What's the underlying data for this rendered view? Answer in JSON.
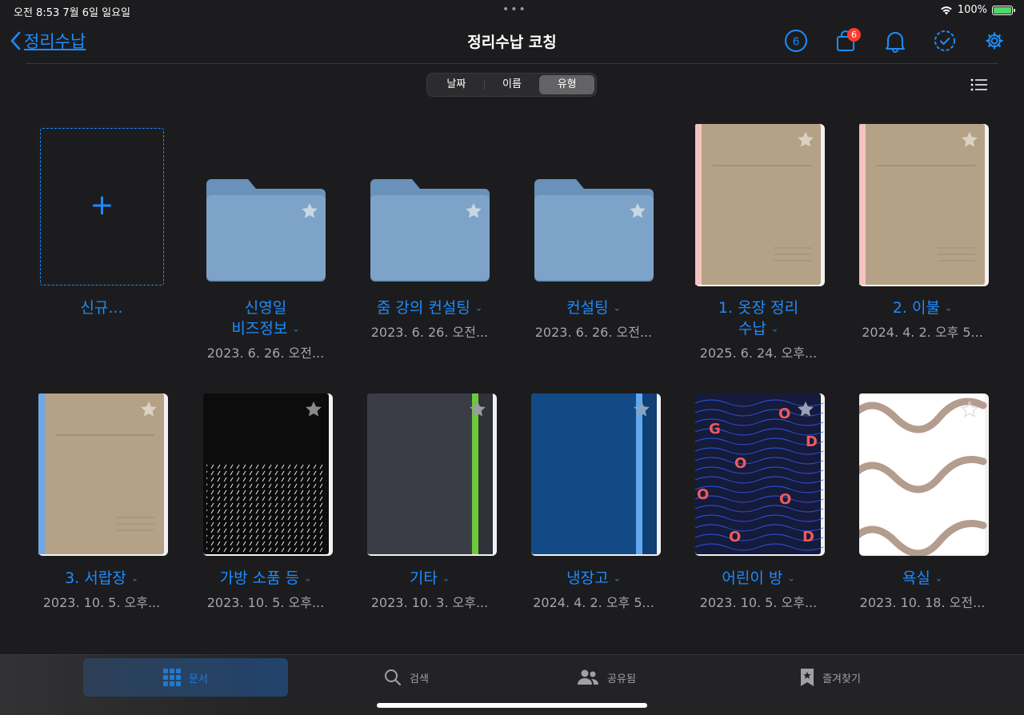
{
  "status": {
    "time": "오전 8:53   7월 6일 일요일",
    "battery": "100%"
  },
  "nav": {
    "back_label": "정리수납",
    "title": "정리수납 코칭",
    "timer_count": "6",
    "cart_badge": "6"
  },
  "sort": {
    "options": [
      "날짜",
      "이름",
      "유형"
    ],
    "active": "유형"
  },
  "new_item": {
    "label": "신규..."
  },
  "items": [
    {
      "label1": "신영일",
      "label2": "비즈정보",
      "date": "2023. 6. 26. 오전..."
    },
    {
      "label1": "줌 강의 컨설팅",
      "date": "2023. 6. 26. 오전..."
    },
    {
      "label1": "컨설팅",
      "date": "2023. 6. 26. 오전..."
    },
    {
      "label1": "1. 옷장 정리",
      "label2": "수납",
      "date": "2025. 6. 24. 오후..."
    },
    {
      "label1": "2. 이불",
      "date": "2024. 4. 2. 오후 5..."
    },
    {
      "label1": "3. 서랍장",
      "date": "2023. 10. 5. 오후..."
    },
    {
      "label1": "가방 소품 등",
      "date": "2023. 10. 5. 오후..."
    },
    {
      "label1": "기타",
      "date": "2023. 10. 3. 오후..."
    },
    {
      "label1": "냉장고",
      "date": "2024. 4. 2. 오후 5..."
    },
    {
      "label1": "어린이 방",
      "date": "2023. 10. 5. 오후..."
    },
    {
      "label1": "욕실",
      "date": "2023. 10. 18. 오전..."
    }
  ],
  "cover_letters": [
    "G",
    "O",
    "D",
    "O",
    "O",
    "O",
    "O",
    "D"
  ],
  "tabs": [
    {
      "label": "문서",
      "icon": "grid-icon"
    },
    {
      "label": "검색",
      "icon": "search-icon"
    },
    {
      "label": "공유됨",
      "icon": "people-icon"
    },
    {
      "label": "즐겨찾기",
      "icon": "bookmark-star-icon"
    }
  ],
  "colors": {
    "accent": "#1c8cff",
    "background": "#1c1c1e",
    "folder": "#7da2c8",
    "kraft": "#b5a185",
    "badge": "#ff3b30"
  }
}
